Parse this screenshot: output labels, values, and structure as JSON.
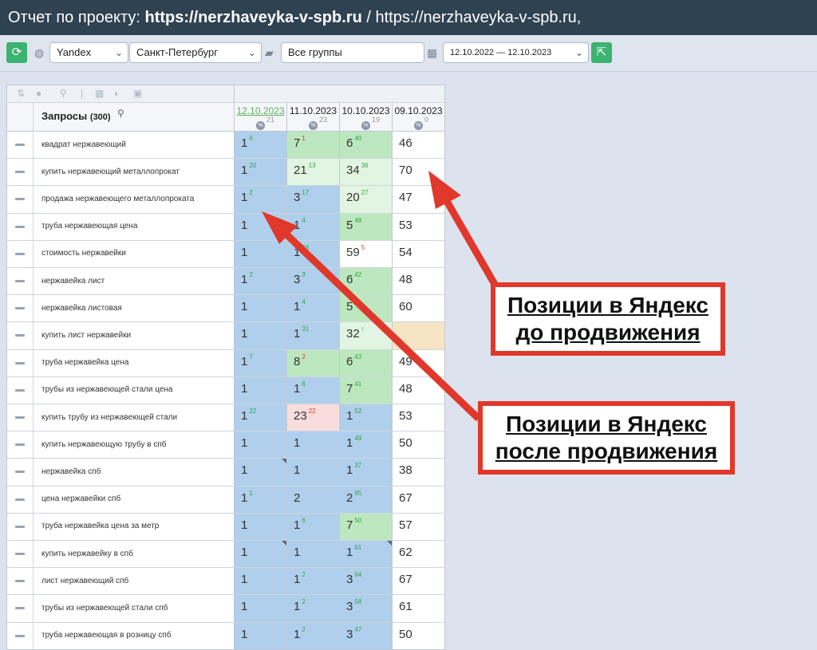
{
  "header": {
    "prefix": "Отчет по проекту: ",
    "project": "https://nerzhaveyka-v-spb.ru",
    "suffix": " / https://nerzhaveyka-v-spb.ru,"
  },
  "toolbar": {
    "engine": "Yandex",
    "region": "Санкт-Петербург",
    "group": "Все группы",
    "date_range": "12.10.2022 — 12.10.2023"
  },
  "table": {
    "title": "Запросы",
    "count": "(300)",
    "dates": [
      {
        "date": "12.10.2023",
        "count": "21",
        "current": true
      },
      {
        "date": "11.10.2023",
        "count": "23",
        "current": false
      },
      {
        "date": "10.10.2023",
        "count": "19",
        "current": false
      },
      {
        "date": "09.10.2023",
        "count": "0",
        "current": false
      }
    ],
    "rows": [
      {
        "q": "квадрат нержавеющий",
        "c": [
          {
            "v": "1",
            "d": "6",
            "s": "g",
            "bg": "b"
          },
          {
            "v": "7",
            "d": "1",
            "s": "r",
            "bg": "g1"
          },
          {
            "v": "6",
            "d": "40",
            "s": "g",
            "bg": "g1"
          },
          {
            "v": "46",
            "bg": "w"
          }
        ]
      },
      {
        "q": "купить нержавеющий металлопрокат",
        "c": [
          {
            "v": "1",
            "d": "20",
            "s": "g",
            "bg": "b"
          },
          {
            "v": "21",
            "d": "13",
            "s": "g",
            "bg": "gl"
          },
          {
            "v": "34",
            "d": "36",
            "s": "g",
            "bg": "gl"
          },
          {
            "v": "70",
            "bg": "w"
          }
        ]
      },
      {
        "q": "продажа нержавеющего металлопроката",
        "c": [
          {
            "v": "1",
            "d": "2",
            "s": "g",
            "bg": "b"
          },
          {
            "v": "3",
            "d": "17",
            "s": "g",
            "bg": "b"
          },
          {
            "v": "20",
            "d": "27",
            "s": "g",
            "bg": "gl"
          },
          {
            "v": "47",
            "bg": "w"
          }
        ]
      },
      {
        "q": "труба нержавеющая цена",
        "c": [
          {
            "v": "1",
            "bg": "b"
          },
          {
            "v": "1",
            "d": "4",
            "s": "g",
            "bg": "b"
          },
          {
            "v": "5",
            "d": "48",
            "s": "g",
            "bg": "g1"
          },
          {
            "v": "53",
            "bg": "w"
          }
        ]
      },
      {
        "q": "стоимость нержавейки",
        "c": [
          {
            "v": "1",
            "bg": "b"
          },
          {
            "v": "1",
            "d": "58",
            "s": "g",
            "bg": "b"
          },
          {
            "v": "59",
            "d": "5",
            "s": "r",
            "bg": "w"
          },
          {
            "v": "54",
            "bg": "w"
          }
        ]
      },
      {
        "q": "нержавейка лист",
        "c": [
          {
            "v": "1",
            "d": "2",
            "s": "g",
            "bg": "b"
          },
          {
            "v": "3",
            "d": "3",
            "s": "g",
            "bg": "b"
          },
          {
            "v": "6",
            "d": "42",
            "s": "g",
            "bg": "g1"
          },
          {
            "v": "48",
            "bg": "w"
          }
        ]
      },
      {
        "q": "нержавейка листовая",
        "c": [
          {
            "v": "1",
            "bg": "b"
          },
          {
            "v": "1",
            "d": "4",
            "s": "g",
            "bg": "b"
          },
          {
            "v": "5",
            "bg": "g1"
          },
          {
            "v": "60",
            "bg": "w"
          }
        ]
      },
      {
        "q": "купить лист нержавейки",
        "c": [
          {
            "v": "1",
            "bg": "b"
          },
          {
            "v": "1",
            "d": "31",
            "s": "g",
            "bg": "b"
          },
          {
            "v": "32",
            "d": "↑",
            "s": "g",
            "bg": "gl"
          },
          {
            "v": "",
            "bg": "y"
          }
        ]
      },
      {
        "q": "труба нержавейка цена",
        "c": [
          {
            "v": "1",
            "d": "7",
            "s": "g",
            "bg": "b"
          },
          {
            "v": "8",
            "d": "2",
            "s": "r",
            "bg": "g1"
          },
          {
            "v": "6",
            "d": "43",
            "s": "g",
            "bg": "g1"
          },
          {
            "v": "49",
            "bg": "w"
          }
        ]
      },
      {
        "q": "трубы из нержавеющей стали цена",
        "c": [
          {
            "v": "1",
            "bg": "b"
          },
          {
            "v": "1",
            "d": "6",
            "s": "g",
            "bg": "b"
          },
          {
            "v": "7",
            "d": "41",
            "s": "g",
            "bg": "g1"
          },
          {
            "v": "48",
            "bg": "w"
          }
        ]
      },
      {
        "q": "купить трубу из нержавеющей стали",
        "c": [
          {
            "v": "1",
            "d": "22",
            "s": "g",
            "bg": "b"
          },
          {
            "v": "23",
            "d": "22",
            "s": "r",
            "bg": "p"
          },
          {
            "v": "1",
            "d": "52",
            "s": "g",
            "bg": "b"
          },
          {
            "v": "53",
            "bg": "w"
          }
        ]
      },
      {
        "q": "купить нержавеющую трубу в спб",
        "c": [
          {
            "v": "1",
            "bg": "b"
          },
          {
            "v": "1",
            "bg": "b"
          },
          {
            "v": "1",
            "d": "49",
            "s": "g",
            "bg": "b"
          },
          {
            "v": "50",
            "bg": "w"
          }
        ]
      },
      {
        "q": "нержавейка спб",
        "c": [
          {
            "v": "1",
            "bg": "b",
            "corner": true
          },
          {
            "v": "1",
            "bg": "b"
          },
          {
            "v": "1",
            "d": "37",
            "s": "g",
            "bg": "b"
          },
          {
            "v": "38",
            "bg": "w"
          }
        ]
      },
      {
        "q": "цена нержавейки спб",
        "c": [
          {
            "v": "1",
            "d": "1",
            "s": "g",
            "bg": "b"
          },
          {
            "v": "2",
            "bg": "b"
          },
          {
            "v": "2",
            "d": "65",
            "s": "g",
            "bg": "b"
          },
          {
            "v": "67",
            "bg": "w"
          }
        ]
      },
      {
        "q": "труба нержавейка цена за метр",
        "c": [
          {
            "v": "1",
            "bg": "b"
          },
          {
            "v": "1",
            "d": "6",
            "s": "g",
            "bg": "b"
          },
          {
            "v": "7",
            "d": "50",
            "s": "g",
            "bg": "g1"
          },
          {
            "v": "57",
            "bg": "w"
          }
        ]
      },
      {
        "q": "купить нержавейку в спб",
        "c": [
          {
            "v": "1",
            "bg": "b",
            "corner": true
          },
          {
            "v": "1",
            "bg": "b"
          },
          {
            "v": "1",
            "d": "61",
            "s": "g",
            "bg": "b",
            "corner": true
          },
          {
            "v": "62",
            "bg": "w"
          }
        ]
      },
      {
        "q": "лист нержавеющий спб",
        "c": [
          {
            "v": "1",
            "bg": "b"
          },
          {
            "v": "1",
            "d": "2",
            "s": "g",
            "bg": "b"
          },
          {
            "v": "3",
            "d": "64",
            "s": "g",
            "bg": "b"
          },
          {
            "v": "67",
            "bg": "w"
          }
        ]
      },
      {
        "q": "трубы из нержавеющей стали спб",
        "c": [
          {
            "v": "1",
            "bg": "b"
          },
          {
            "v": "1",
            "d": "2",
            "s": "g",
            "bg": "b"
          },
          {
            "v": "3",
            "d": "58",
            "s": "g",
            "bg": "b"
          },
          {
            "v": "61",
            "bg": "w"
          }
        ]
      },
      {
        "q": "труба нержавеющая в розницу спб",
        "c": [
          {
            "v": "1",
            "bg": "b"
          },
          {
            "v": "1",
            "d": "2",
            "s": "g",
            "bg": "b"
          },
          {
            "v": "3",
            "d": "47",
            "s": "g",
            "bg": "b"
          },
          {
            "v": "50",
            "bg": "w"
          }
        ]
      }
    ]
  },
  "annotations": {
    "before": [
      "Позиции в Яндекс",
      "до продвижения"
    ],
    "after": [
      "Позиции в Яндекс",
      "после продвижения"
    ],
    "accent_color": "#e0382a"
  }
}
